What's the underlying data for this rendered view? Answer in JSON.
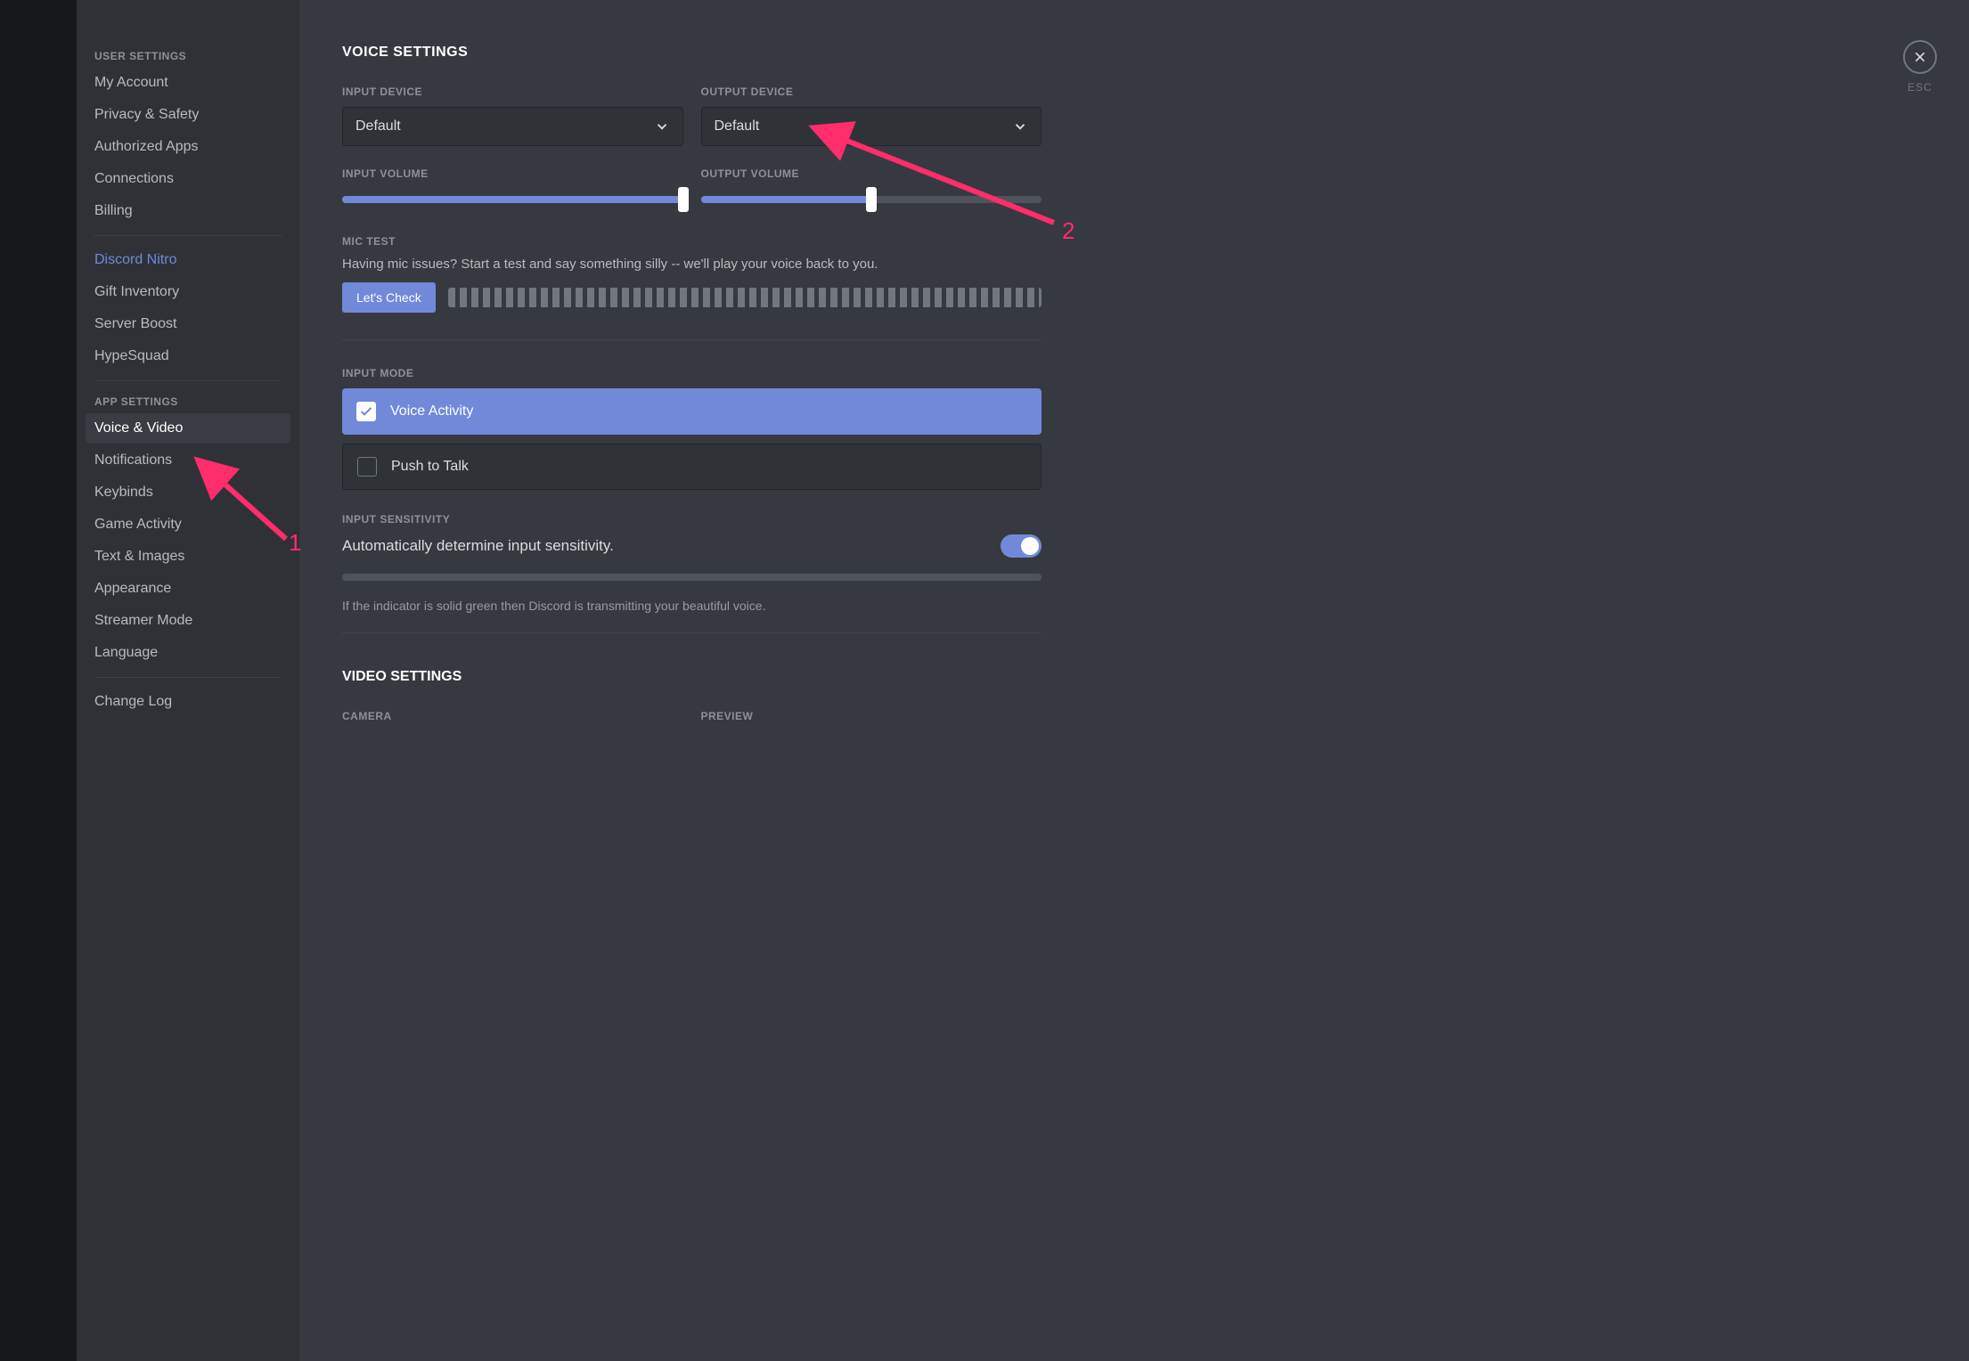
{
  "sidebar": {
    "sections": {
      "user_settings_header": "USER SETTINGS",
      "app_settings_header": "APP SETTINGS"
    },
    "items": {
      "my_account": "My Account",
      "privacy_safety": "Privacy & Safety",
      "authorized_apps": "Authorized Apps",
      "connections": "Connections",
      "billing": "Billing",
      "discord_nitro": "Discord Nitro",
      "gift_inventory": "Gift Inventory",
      "server_boost": "Server Boost",
      "hypesquad": "HypeSquad",
      "voice_video": "Voice & Video",
      "notifications": "Notifications",
      "keybinds": "Keybinds",
      "game_activity": "Game Activity",
      "text_images": "Text & Images",
      "appearance": "Appearance",
      "streamer_mode": "Streamer Mode",
      "language": "Language",
      "change_log": "Change Log"
    }
  },
  "main": {
    "title": "VOICE SETTINGS",
    "input_device_label": "INPUT DEVICE",
    "output_device_label": "OUTPUT DEVICE",
    "input_device_value": "Default",
    "output_device_value": "Default",
    "input_volume_label": "INPUT VOLUME",
    "output_volume_label": "OUTPUT VOLUME",
    "input_volume_pct": 100,
    "output_volume_pct": 50,
    "mic_test_label": "MIC TEST",
    "mic_test_desc": "Having mic issues? Start a test and say something silly -- we'll play your voice back to you.",
    "lets_check_label": "Let's Check",
    "input_mode_label": "INPUT MODE",
    "input_mode_voice_activity": "Voice Activity",
    "input_mode_push_to_talk": "Push to Talk",
    "input_sensitivity_label": "INPUT SENSITIVITY",
    "auto_sensitivity_text": "Automatically determine input sensitivity.",
    "sensitivity_hint": "If the indicator is solid green then Discord is transmitting your beautiful voice.",
    "video_settings_title": "VIDEO SETTINGS",
    "camera_label": "CAMERA",
    "preview_label": "PREVIEW"
  },
  "close": {
    "label": "ESC"
  },
  "annotations": {
    "num1": "1",
    "num2": "2"
  }
}
